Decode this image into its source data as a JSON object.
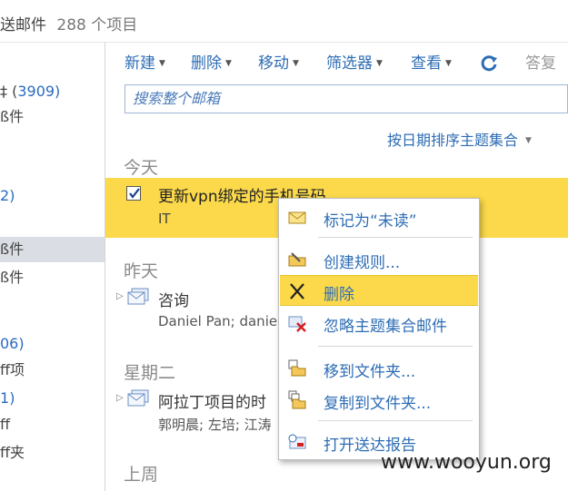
{
  "header": {
    "title": "送邮件",
    "count": "288 个项目"
  },
  "leftnav": {
    "items": [
      {
        "text": "‡ (",
        "count": "3909",
        "suffix": ")"
      },
      {
        "text": "ß件",
        "count": "",
        "suffix": ""
      },
      {
        "text": "",
        "count": "2",
        "suffix": ")"
      },
      {
        "text": "ß件",
        "count": "",
        "suffix": ""
      },
      {
        "text": "ß件",
        "count": "",
        "suffix": ""
      },
      {
        "text": "",
        "count": "06",
        "suffix": ")"
      },
      {
        "text": "ff项",
        "count": "",
        "suffix": ""
      },
      {
        "text": "",
        "count": "1",
        "suffix": ")"
      },
      {
        "text": "ff",
        "count": "",
        "suffix": ""
      },
      {
        "text": "ff夹",
        "count": "",
        "suffix": ""
      }
    ]
  },
  "toolbar": {
    "new_label": "新建",
    "delete_label": "删除",
    "move_label": "移动",
    "filter_label": "筛选器",
    "view_label": "查看",
    "reply_label": "答复"
  },
  "search": {
    "placeholder": "搜索整个邮箱"
  },
  "sort": {
    "label": "按日期排序主题集合"
  },
  "groups": {
    "today": "今天",
    "yesterday": "昨天",
    "tuesday": "星期二",
    "last_week": "上周"
  },
  "messages": [
    {
      "subject": "更新vpn绑定的手机号码",
      "from": "IT"
    },
    {
      "subject": "咨询",
      "from": "Daniel Pan; danie"
    },
    {
      "subject": "阿拉丁项目的时",
      "from": "郭明晨; 左培; 江涛"
    }
  ],
  "context_menu": {
    "items": [
      {
        "label": "标记为“未读”",
        "icon": "envelope-icon"
      },
      {
        "label": "创建规则...",
        "icon": "folder-rule-icon"
      },
      {
        "label": "删除",
        "icon": "delete-x-icon"
      },
      {
        "label": "忽略主题集合邮件",
        "icon": "ignore-conversation-icon"
      },
      {
        "label": "移到文件夹...",
        "icon": "move-to-folder-icon"
      },
      {
        "label": "复制到文件夹...",
        "icon": "copy-to-folder-icon"
      },
      {
        "label": "打开送达报告",
        "icon": "delivery-report-icon"
      }
    ]
  },
  "watermark": "www.wooyun.org",
  "colors": {
    "accent": "#2e6db4",
    "selection": "#fbd94b",
    "nav_selected": "#dadde3"
  }
}
